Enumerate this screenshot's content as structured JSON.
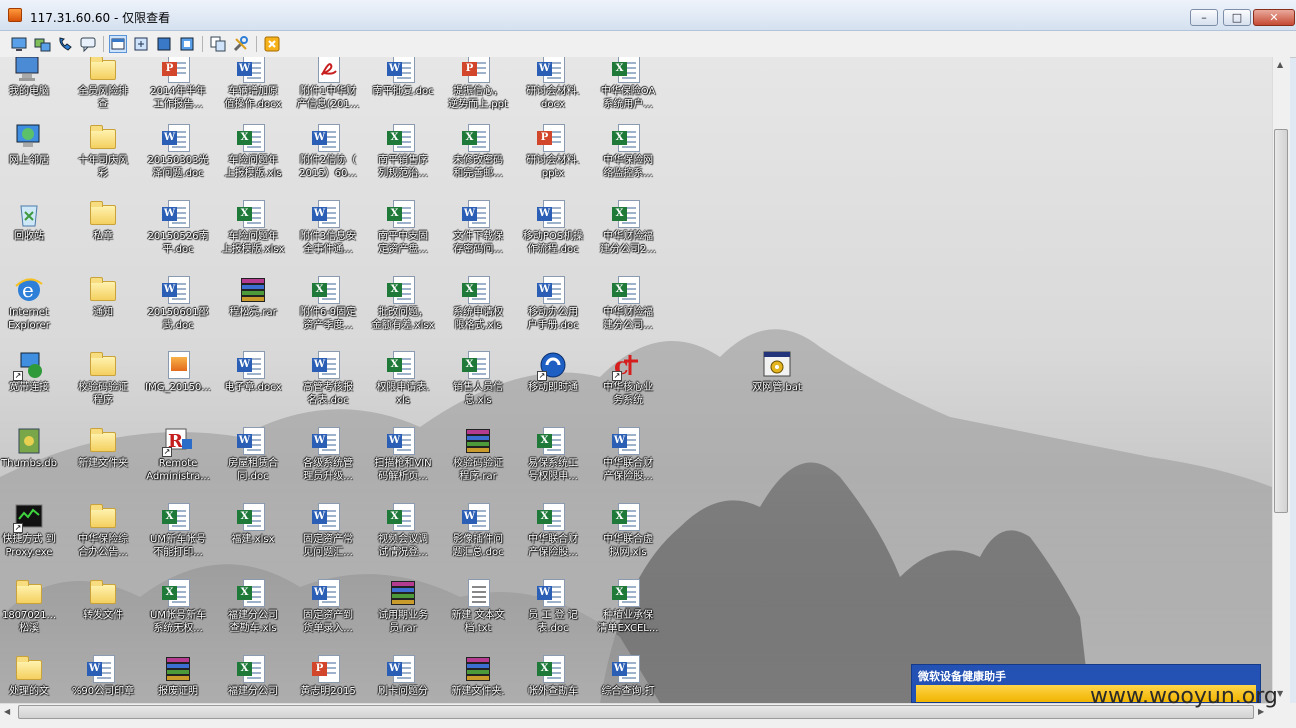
{
  "window": {
    "title": "117.31.60.60 - 仅限查看",
    "minimize": "–",
    "maximize": "□",
    "close": "✕"
  },
  "toolbar": {
    "buttons": [
      "screen-icon",
      "transfer-icon",
      "phone-icon",
      "chat-icon",
      "view-window-icon",
      "view-fit-icon",
      "view-full-icon",
      "view-scale-icon",
      "copy-icon",
      "tools-icon",
      "disconnect-icon"
    ]
  },
  "desktop": {
    "columns": [
      [
        {
          "label": "我的电脑",
          "type": "computer"
        },
        {
          "label": "网上邻居",
          "type": "network"
        },
        {
          "label": "回收站",
          "type": "recycle"
        },
        {
          "label": "Internet\nExplorer",
          "type": "ie"
        },
        {
          "label": "宽带连接",
          "type": "dialup"
        },
        {
          "label": "Thumbs.db",
          "type": "db"
        },
        {
          "label": "快捷方式 到\nProxy.exe",
          "type": "proxy"
        },
        {
          "label": "1807021...\n松溪",
          "type": "folder"
        },
        {
          "label": "处理的文",
          "type": "folder"
        }
      ],
      [
        {
          "label": "全员风险排\n查",
          "type": "folder"
        },
        {
          "label": "十年司庆风\n彩",
          "type": "folder"
        },
        {
          "label": "私章",
          "type": "folder"
        },
        {
          "label": "通知",
          "type": "folder"
        },
        {
          "label": "校验码验证\n程序",
          "type": "folder"
        },
        {
          "label": "新建文件夹",
          "type": "folder"
        },
        {
          "label": "中华保险综\n合办公告...",
          "type": "folder"
        },
        {
          "label": "转发文件",
          "type": "folder"
        },
        {
          "label": "%90公司印章",
          "type": "word"
        }
      ],
      [
        {
          "label": "2014年半年\n工作报告...",
          "type": "ppt"
        },
        {
          "label": "20150303光\n泽问题.doc",
          "type": "word"
        },
        {
          "label": "20150526南\n平.doc",
          "type": "word"
        },
        {
          "label": "20150601邵\n武.doc",
          "type": "word"
        },
        {
          "label": "IMG_20150...",
          "type": "image"
        },
        {
          "label": "Remote\nAdministra...",
          "type": "remote"
        },
        {
          "label": "UM新车帐号\n不能打印...",
          "type": "excel"
        },
        {
          "label": "UM帐号新车\n系统无权...",
          "type": "excel"
        },
        {
          "label": "报废证明",
          "type": "rar"
        }
      ],
      [
        {
          "label": "车辆增加原\n值操作.docx",
          "type": "word"
        },
        {
          "label": "车险问题年\n上报模版.xls",
          "type": "excel"
        },
        {
          "label": "车险问题年\n上报模版.xlsx",
          "type": "excel"
        },
        {
          "label": "程松亮.rar",
          "type": "rar"
        },
        {
          "label": "电子章.docx",
          "type": "word"
        },
        {
          "label": "房屋租赁合\n同.doc",
          "type": "word"
        },
        {
          "label": "福建.xlsx",
          "type": "excel"
        },
        {
          "label": "福建分公司\n查勘车.xls",
          "type": "excel"
        },
        {
          "label": "福建分公司",
          "type": "excel"
        }
      ],
      [
        {
          "label": "附件1中华财\n产信息(201...",
          "type": "pdf"
        },
        {
          "label": "附件2信协（\n2015）60...",
          "type": "word"
        },
        {
          "label": "附件3信息安\n全事件通...",
          "type": "word"
        },
        {
          "label": "附件6-9固定\n资产季度...",
          "type": "excel"
        },
        {
          "label": "高管考核报\n名表.doc",
          "type": "word"
        },
        {
          "label": "各级系统管\n理员升级...",
          "type": "word"
        },
        {
          "label": "固定资产常\n见问题汇...",
          "type": "word"
        },
        {
          "label": "固定资产到\n货单录入...",
          "type": "word"
        },
        {
          "label": "黄志明2015",
          "type": "ppt"
        }
      ],
      [
        {
          "label": "南平批复.doc",
          "type": "word"
        },
        {
          "label": "南平销售序\n列规范治...",
          "type": "excel"
        },
        {
          "label": "南平中支固\n定资产盘...",
          "type": "excel"
        },
        {
          "label": "批改问题，\n金额有差.xlsx",
          "type": "excel"
        },
        {
          "label": "权限申请表.\nxls",
          "type": "excel"
        },
        {
          "label": "扫描枪和VIN\n码解析页...",
          "type": "word"
        },
        {
          "label": "视频会议调\n试情况登...",
          "type": "excel"
        },
        {
          "label": "试用期业务\n员.rar",
          "type": "rar"
        },
        {
          "label": "刷卡问题分",
          "type": "word"
        }
      ],
      [
        {
          "label": "提振信心，\n逆势而上.ppt",
          "type": "ppt"
        },
        {
          "label": "未修改密码\n和完善邮...",
          "type": "excel"
        },
        {
          "label": "文件下载保\n存密码问...",
          "type": "word"
        },
        {
          "label": "系统申请权\n限格式.xls",
          "type": "excel"
        },
        {
          "label": "销售人员信\n息.xls",
          "type": "excel"
        },
        {
          "label": "校验码验证\n程序.rar",
          "type": "rar"
        },
        {
          "label": "影像插件问\n题汇总.doc",
          "type": "word"
        },
        {
          "label": "新建 文本文\n档.txt",
          "type": "text"
        },
        {
          "label": "新建文件夹.",
          "type": "rar"
        }
      ],
      [
        {
          "label": "研讨会材料.\ndocx",
          "type": "word"
        },
        {
          "label": "研讨会材料.\npptx",
          "type": "ppt"
        },
        {
          "label": "移动POS机操\n作流程.doc",
          "type": "word"
        },
        {
          "label": "移动办公用\n户手册.doc",
          "type": "word"
        },
        {
          "label": "移动即时通",
          "type": "mobile"
        },
        {
          "label": "易保系统工\n号权限申...",
          "type": "excel"
        },
        {
          "label": "中华联合财\n产保险股...",
          "type": "excel"
        },
        {
          "label": "员 工 登 记\n表.doc",
          "type": "word"
        },
        {
          "label": "帐外查勘车",
          "type": "excel"
        }
      ],
      [
        {
          "label": "中华保险OA\n系统用户...",
          "type": "excel"
        },
        {
          "label": "中华保险网\n络监控系...",
          "type": "excel"
        },
        {
          "label": "中华财险福\n建分公司2...",
          "type": "excel"
        },
        {
          "label": "中华财险福\n建分公司...",
          "type": "excel"
        },
        {
          "label": "中华核心业\n务系统",
          "type": "core"
        },
        {
          "label": "中华联合财\n产保险股...",
          "type": "word"
        },
        {
          "label": "中华联合虚\n拟网.xls",
          "type": "excel"
        },
        {
          "label": "种植业承保\n清单EXCEL...",
          "type": "excel"
        },
        {
          "label": "综合查询.打",
          "type": "word"
        }
      ]
    ],
    "extra_icon": {
      "label": "双网管.bat",
      "type": "bat"
    }
  },
  "popup": {
    "title": "微软设备健康助手"
  },
  "watermark": "www.wooyun.org",
  "colors": {
    "word": "#2b5fb5",
    "excel": "#1f7a3a",
    "ppt": "#d2462b",
    "pdf": "#c81e1e",
    "rar": "#7a2a8c",
    "folder": "#f4d060"
  }
}
